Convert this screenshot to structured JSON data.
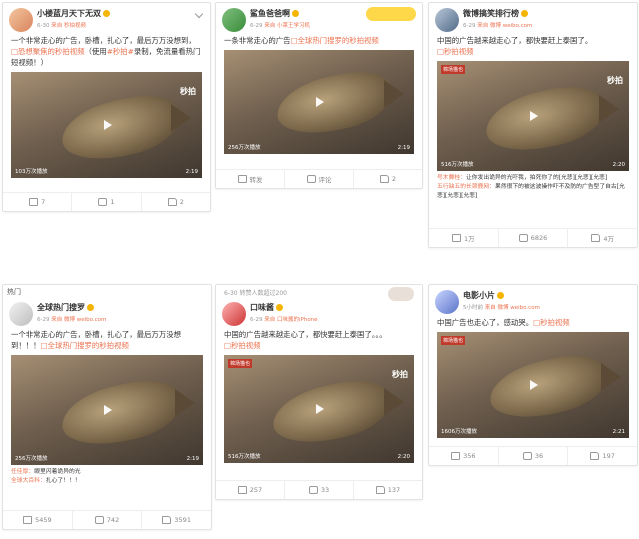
{
  "cards": [
    {
      "user": "小楼蓝月天下无双",
      "time": "6-30",
      "source": "来自 秒拍视频",
      "text_pre": "一个非常走心的广告，卧槽，扎心了，最后万万没想到，",
      "link1": "□恐想聚焦的秒拍视频",
      "text_mid": "（使用",
      "link2": "#秒拍#",
      "text_post": "录制，免流量看热门短视频！）",
      "video_count": "103万次播放",
      "video_time": "2:19",
      "watermark": "秒拍",
      "actions": [
        "7",
        "1",
        "2"
      ]
    },
    {
      "user": "鲨鱼爸爸啊",
      "time": "6-29",
      "source": "来自 小莱王学习机",
      "text_pre": "一条非常走心的广告",
      "link1": "□全球热门搜罗的秒拍视频",
      "video_count": "256万次播放",
      "video_time": "2:19",
      "actions": [
        "转发",
        "评论",
        "2"
      ]
    },
    {
      "user": "微博搞笑排行榜",
      "time": "6-29",
      "source": "来自 微博 weibo.com",
      "text_pre": "中国的广告越来越走心了，都快要赶上泰国了。",
      "link1": "□秒拍视频",
      "video_count": "516万次播放",
      "video_time": "2:20",
      "watermark": "秒拍",
      "tag": "棉场猫也",
      "comments": [
        {
          "who": "号木舞桂：",
          "text": "让你发出诡异的光吓我，拍死你了的[允悲][允悲][允悲]"
        },
        {
          "who": "五行缺五的长颈鹿网：",
          "text": "果然很下的被这波操作吓不及防的广告型了自古[允悲][允悲][允悲]"
        }
      ],
      "actions": [
        "1万",
        "6826",
        "4万"
      ]
    },
    {
      "section": "热门",
      "user": "全球热门搜罗",
      "time": "6-29",
      "source": "来自 微博 weibo.com",
      "text_pre": "一个非常走心的广告，卧槽，扎心了，最后万万没想到！！！",
      "link1": "□全球热门搜罗的秒拍视频",
      "video_count": "256万次播放",
      "video_time": "2:19",
      "comments": [
        {
          "who": "任佳厚：",
          "text": "眼里闪着诡异的光"
        },
        {
          "who": "全球大百科：",
          "text": "扎心了！！！"
        }
      ],
      "actions": [
        "5459",
        "742",
        "3591"
      ]
    },
    {
      "topline": "6-30 转赞人数超过200",
      "user": "口味酱",
      "time": "6-29",
      "source": "来自 口味酱的iPhone",
      "text_pre": "中国的广告越来越走心了，都快要赶上泰国了。。。",
      "link1": "□秒拍视频",
      "video_count": "516万次播放",
      "video_time": "2:20",
      "watermark": "秒拍",
      "tag": "棉场猫也",
      "actions": [
        "257",
        "33",
        "137"
      ]
    },
    {
      "user": "电影小片",
      "time": "5小时前",
      "source": "来自 微博 weibo.com",
      "text_pre": "中国广告也走心了，感动哭。",
      "link1": "□秒拍视频",
      "video_count": "1606万次播放",
      "video_time": "2:21",
      "tag": "棉场猫也",
      "actions": [
        "356",
        "36",
        "197"
      ]
    }
  ]
}
